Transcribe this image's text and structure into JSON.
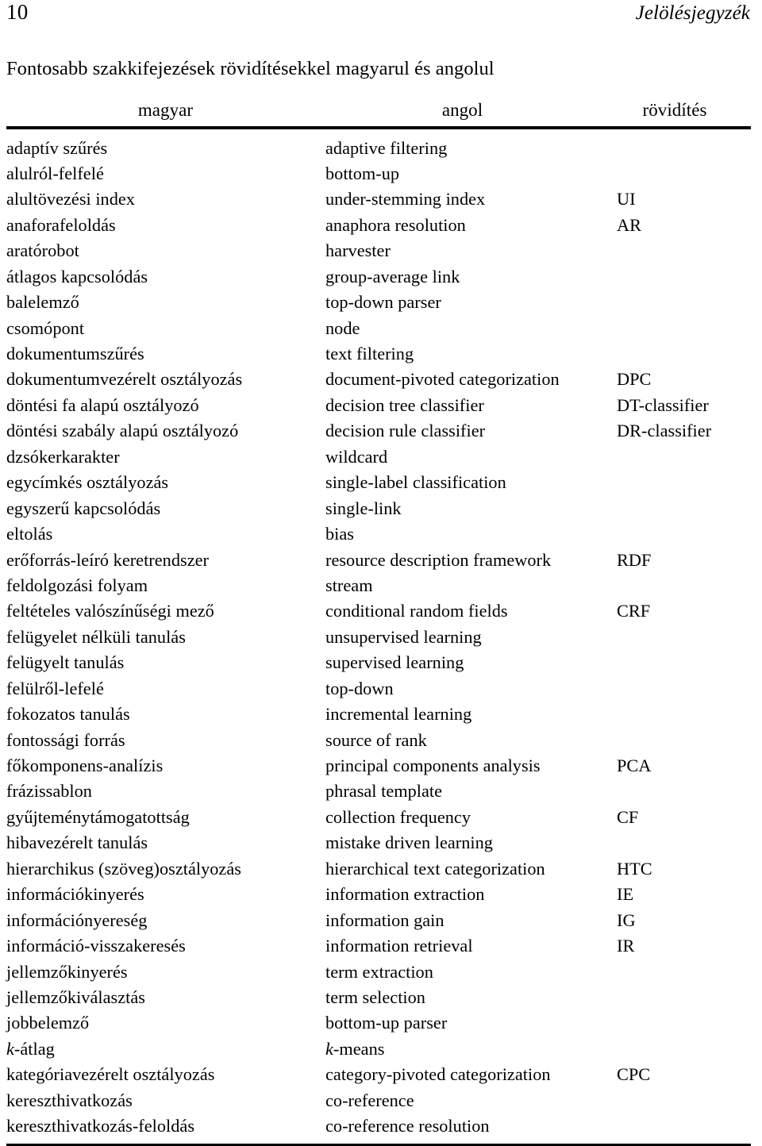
{
  "page": {
    "folio": "10",
    "running_head": "Jelölésjegyzék"
  },
  "table": {
    "caption": "Fontosabb szakkifejezések rövidítésekkel magyarul és angolul",
    "headers": {
      "hungarian": "magyar",
      "english": "angol",
      "abbreviation": "rövidítés"
    },
    "rows": [
      {
        "hu": "adaptív szűrés",
        "en": "adaptive filtering",
        "abb": ""
      },
      {
        "hu": "alulról-felfelé",
        "en": "bottom-up",
        "abb": ""
      },
      {
        "hu": "alultövezési index",
        "en": "under-stemming index",
        "abb": "UI"
      },
      {
        "hu": "anaforafeloldás",
        "en": "anaphora resolution",
        "abb": "AR"
      },
      {
        "hu": "aratórobot",
        "en": "harvester",
        "abb": ""
      },
      {
        "hu": "átlagos kapcsolódás",
        "en": "group-average link",
        "abb": ""
      },
      {
        "hu": "balelemző",
        "en": "top-down parser",
        "abb": ""
      },
      {
        "hu": "csomópont",
        "en": "node",
        "abb": ""
      },
      {
        "hu": "dokumentumszűrés",
        "en": "text filtering",
        "abb": ""
      },
      {
        "hu": "dokumentumvezérelt osztályozás",
        "en": "document-pivoted categorization",
        "abb": "DPC"
      },
      {
        "hu": "döntési fa alapú osztályozó",
        "en": "decision tree classifier",
        "abb": "DT-classifier"
      },
      {
        "hu": "döntési szabály alapú osztályozó",
        "en": "decision rule classifier",
        "abb": "DR-classifier"
      },
      {
        "hu": "dzsókerkarakter",
        "en": "wildcard",
        "abb": ""
      },
      {
        "hu": "egycímkés osztályozás",
        "en": "single-label classification",
        "abb": ""
      },
      {
        "hu": "egyszerű kapcsolódás",
        "en": "single-link",
        "abb": ""
      },
      {
        "hu": "eltolás",
        "en": "bias",
        "abb": ""
      },
      {
        "hu": "erőforrás-leíró keretrendszer",
        "en": "resource description framework",
        "abb": "RDF"
      },
      {
        "hu": "feldolgozási folyam",
        "en": "stream",
        "abb": ""
      },
      {
        "hu": "feltételes valószínűségi mező",
        "en": "conditional random fields",
        "abb": "CRF"
      },
      {
        "hu": "felügyelet nélküli tanulás",
        "en": "unsupervised learning",
        "abb": ""
      },
      {
        "hu": "felügyelt tanulás",
        "en": "supervised learning",
        "abb": ""
      },
      {
        "hu": "felülről-lefelé",
        "en": "top-down",
        "abb": ""
      },
      {
        "hu": "fokozatos tanulás",
        "en": "incremental learning",
        "abb": ""
      },
      {
        "hu": "fontossági forrás",
        "en": "source of rank",
        "abb": ""
      },
      {
        "hu": "főkomponens-analízis",
        "en": "principal components analysis",
        "abb": "PCA"
      },
      {
        "hu": "frázissablon",
        "en": "phrasal template",
        "abb": ""
      },
      {
        "hu": "gyűjteménytámogatottság",
        "en": "collection frequency",
        "abb": "CF"
      },
      {
        "hu": "hibavezérelt tanulás",
        "en": "mistake driven learning",
        "abb": ""
      },
      {
        "hu": "hierarchikus (szöveg)osztályozás",
        "en": "hierarchical text categorization",
        "abb": "HTC"
      },
      {
        "hu": "információkinyerés",
        "en": "information extraction",
        "abb": "IE"
      },
      {
        "hu": "információnyereség",
        "en": "information gain",
        "abb": "IG"
      },
      {
        "hu": "információ-visszakeresés",
        "en": "information retrieval",
        "abb": "IR"
      },
      {
        "hu": "jellemzőkinyerés",
        "en": "term extraction",
        "abb": ""
      },
      {
        "hu": "jellemzőkiválasztás",
        "en": "term selection",
        "abb": ""
      },
      {
        "hu": "jobbelemző",
        "en": "bottom-up parser",
        "abb": ""
      },
      {
        "hu": "k-átlag",
        "en": "k-means",
        "abb": "",
        "hu_italic_prefix": "k",
        "hu_rest": "-átlag",
        "en_italic_prefix": "k",
        "en_rest": "-means"
      },
      {
        "hu": "kategóriavezérelt osztályozás",
        "en": "category-pivoted categorization",
        "abb": "CPC"
      },
      {
        "hu": "kereszthivatkozás",
        "en": "co-reference",
        "abb": ""
      },
      {
        "hu": "kereszthivatkozás-feloldás",
        "en": "co-reference resolution",
        "abb": ""
      }
    ]
  }
}
